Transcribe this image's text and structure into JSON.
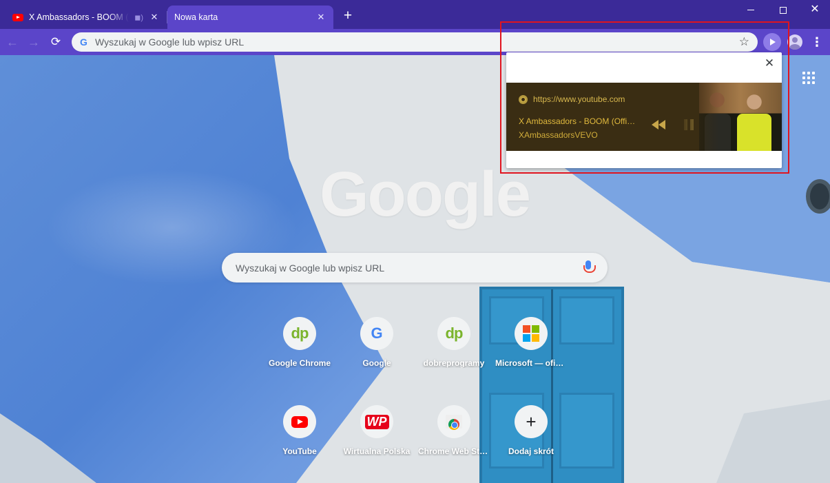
{
  "tabs": [
    {
      "title": "X Ambassadors - BOOM (Official Video)",
      "playing_audio": true
    },
    {
      "title": "Nowa karta",
      "active": true
    }
  ],
  "toolbar": {
    "omnibox_placeholder": "Wyszukaj w Google lub wpisz URL",
    "new_tab_symbol": "+"
  },
  "ntp": {
    "logo_text": "Google",
    "search_placeholder": "Wyszukaj w Google lub wpisz URL",
    "shortcuts": [
      {
        "label": "Google Chrome",
        "icon": "dobreprogramy-icon",
        "glyph": "dp"
      },
      {
        "label": "Google",
        "icon": "google-icon",
        "glyph": "G"
      },
      {
        "label": "dobreprogramy",
        "icon": "dobreprogramy-icon",
        "glyph": "dp"
      },
      {
        "label": "Microsoft — oficjalna strona główna",
        "icon": "microsoft-icon",
        "glyph": ""
      },
      {
        "label": "YouTube",
        "icon": "youtube-icon",
        "glyph": ""
      },
      {
        "label": "Wirtualna Polska",
        "icon": "wp-icon",
        "glyph": "WP"
      },
      {
        "label": "Chrome Web Store",
        "icon": "chrome-web-store-icon",
        "glyph": ""
      },
      {
        "label": "Dodaj skrót",
        "icon": "plus-icon",
        "glyph": "+"
      }
    ]
  },
  "media_popup": {
    "origin": "https://www.youtube.com",
    "title": "X Ambassadors - BOOM (Official Video)",
    "artist": "XAmbassadorsVEVO",
    "state": "playing"
  },
  "colors": {
    "tabstrip": "#3b2a98",
    "toolbar": "#5b45c9",
    "media_card_bg": "#3a2d13",
    "media_text": "#e0b93d",
    "highlight": "#e0141f"
  }
}
